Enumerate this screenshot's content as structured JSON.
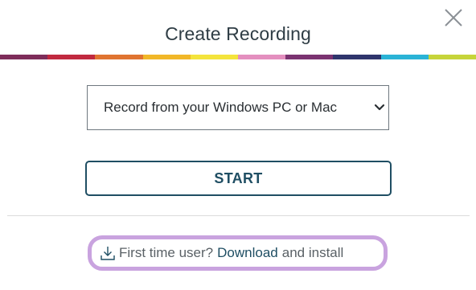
{
  "dialog": {
    "title": "Create Recording",
    "close_icon": "close-icon"
  },
  "stripe_colors": [
    "#7e2d5a",
    "#c1293f",
    "#e07431",
    "#f1b728",
    "#f4e43c",
    "#e48fbf",
    "#7b3371",
    "#2f356c",
    "#2ab3d6",
    "#c6d43a"
  ],
  "record_source": {
    "selected": "Record from your Windows PC or Mac",
    "chevron_icon": "chevron-down-icon"
  },
  "start_button": {
    "label": "START"
  },
  "download_prompt": {
    "icon": "download-icon",
    "prefix": "First time user?",
    "link_label": "Download",
    "suffix": "and install"
  },
  "colors": {
    "title_text": "#2f3d45",
    "primary": "#1f4e63",
    "highlight_border": "#c9a3df"
  }
}
